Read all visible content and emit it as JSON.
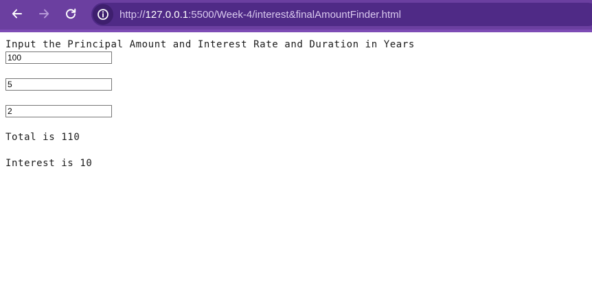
{
  "browser": {
    "url_scheme": "http://",
    "url_host": "127.0.0.1",
    "url_rest": ":5500/Week-4/interest&finalAmountFinder.html",
    "icons": {
      "back": "arrow-left-icon",
      "forward": "arrow-right-icon",
      "reload": "reload-icon",
      "site_info": "info-icon"
    },
    "colors": {
      "toolbar": "#6b3fa0",
      "address_bar": "#4f2a86"
    }
  },
  "page": {
    "prompt": "Input the Principal Amount and Interest Rate and Duration in Years",
    "principal_value": "100",
    "rate_value": "5",
    "years_value": "2",
    "total_text": "Total is 110",
    "interest_text": "Interest is 10"
  }
}
